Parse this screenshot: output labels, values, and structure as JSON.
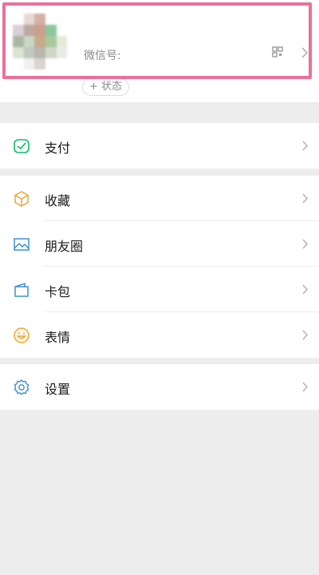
{
  "profile": {
    "wechat_id_label": "微信号:",
    "status_button_label": "+ 状态",
    "qr_icon": "qr-code-icon",
    "avatar_colors": [
      "#ffffff",
      "#e9d8d2",
      "#d3b1a5",
      "#ffffff",
      "#ffffff",
      "#ffffff",
      "#d9cfd6",
      "#bda89f",
      "#c9a08f",
      "#8cc79c",
      "#ffffff",
      "#ffffff",
      "#aab7a6",
      "#c7d8c4",
      "#c8a98b",
      "#a8c9a0",
      "#e4ebd7",
      "#ffffff",
      "#d9e3d2",
      "#c1c9bf",
      "#b8b7ad",
      "#d2d6c9",
      "#e9ece6",
      "#ffffff",
      "#ffffff",
      "#eef0ec",
      "#dad4cf",
      "#ffffff",
      "#ffffff",
      "#ffffff"
    ],
    "highlight_color": "#ea6f9a"
  },
  "menu": {
    "pay": {
      "label": "支付",
      "icon": "pay-check-icon",
      "color": "#07c160"
    },
    "favorites": {
      "label": "收藏",
      "icon": "cube-icon",
      "color": "#e9a93c"
    },
    "moments": {
      "label": "朋友圈",
      "icon": "picture-icon",
      "color": "#3d8fd5"
    },
    "cards": {
      "label": "卡包",
      "icon": "card-wallet-icon",
      "color": "#3d8fd5"
    },
    "stickers": {
      "label": "表情",
      "icon": "smiley-icon",
      "color": "#e9a93c"
    },
    "settings": {
      "label": "设置",
      "icon": "gear-icon",
      "color": "#3d8fd5"
    }
  }
}
